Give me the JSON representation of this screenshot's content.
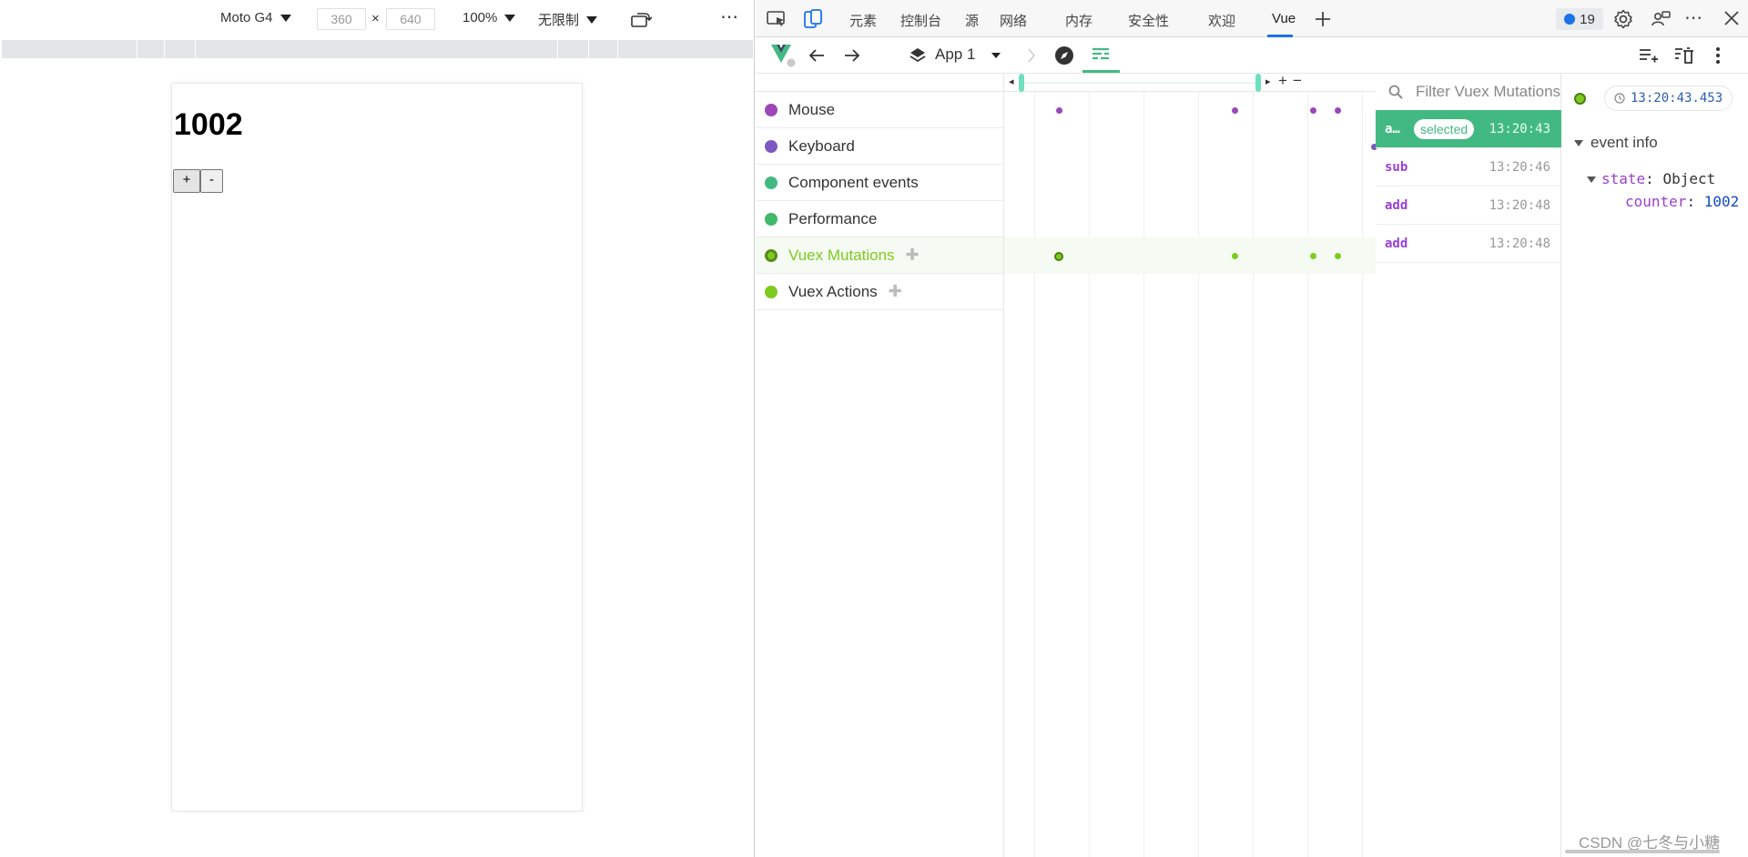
{
  "emulation": {
    "device": "Moto G4",
    "width": "360",
    "height": "640",
    "times": "×",
    "zoom": "100%",
    "throttle": "无限制",
    "more": "⋯"
  },
  "page": {
    "counter": "1002",
    "plus_label": "+",
    "minus_label": "-"
  },
  "devtools": {
    "tabs": [
      "元素",
      "控制台",
      "源",
      "网络",
      "内存",
      "安全性",
      "欢迎",
      "Vue"
    ],
    "active_tab": "Vue",
    "issues_count": "19",
    "app_label": "App 1"
  },
  "layers": [
    {
      "label": "Mouse",
      "color": "#9c46b8"
    },
    {
      "label": "Keyboard",
      "color": "#7e57c2"
    },
    {
      "label": "Component events",
      "color": "#42b983"
    },
    {
      "label": "Performance",
      "color": "#41b86a"
    },
    {
      "label": "Vuex Mutations",
      "color": "#7ecb20"
    },
    {
      "label": "Vuex Actions",
      "color": "#7ecb20"
    }
  ],
  "filter_placeholder": "Filter Vuex Mutations",
  "events": [
    {
      "name": "a…",
      "badge": "selected",
      "time": "13:20:43"
    },
    {
      "name": "sub",
      "time": "13:20:46"
    },
    {
      "name": "add",
      "time": "13:20:48"
    },
    {
      "name": "add",
      "time": "13:20:48"
    }
  ],
  "info": {
    "time": "13:20:43.453",
    "section": "event info",
    "state_key": "state",
    "state_type": "Object",
    "counter_key": "counter",
    "counter_value": "1002"
  },
  "watermark": "CSDN @七冬与小糖",
  "colors": {
    "vue_green": "#42b983",
    "mutation_green": "#7ecb20",
    "mouse_purple": "#9c46b8",
    "accent_blue": "#1a73e8"
  }
}
